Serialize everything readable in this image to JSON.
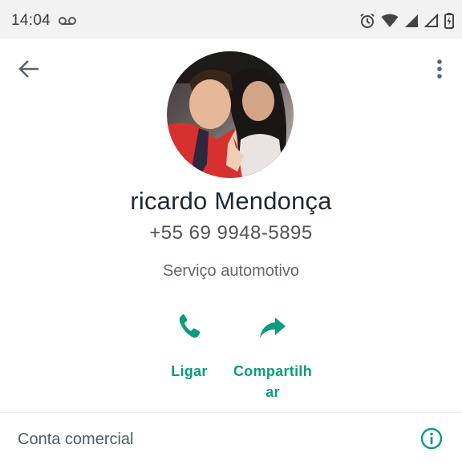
{
  "status_bar": {
    "time": "14:04",
    "icons": [
      "voicemail-icon",
      "alarm-icon",
      "wifi-icon",
      "signal-icon",
      "signal-empty-icon",
      "battery-charging-icon"
    ]
  },
  "header": {
    "back_icon": "arrow-left-icon",
    "menu_icon": "more-vertical-icon"
  },
  "contact": {
    "name": "ricardo Mendonça",
    "phone": "+55 69 9948-5895",
    "category": "Serviço automotivo"
  },
  "actions": {
    "call_label": "Ligar",
    "call_icon": "phone-icon",
    "share_label": "Compartilhar",
    "share_icon": "share-arrow-icon"
  },
  "business": {
    "label": "Conta comercial",
    "icon": "info-icon"
  },
  "colors": {
    "accent": "#0a9c7d",
    "status_bar_bg": "#f2f2f2",
    "text_primary": "#1f2a30",
    "text_secondary": "#5f6b72"
  }
}
